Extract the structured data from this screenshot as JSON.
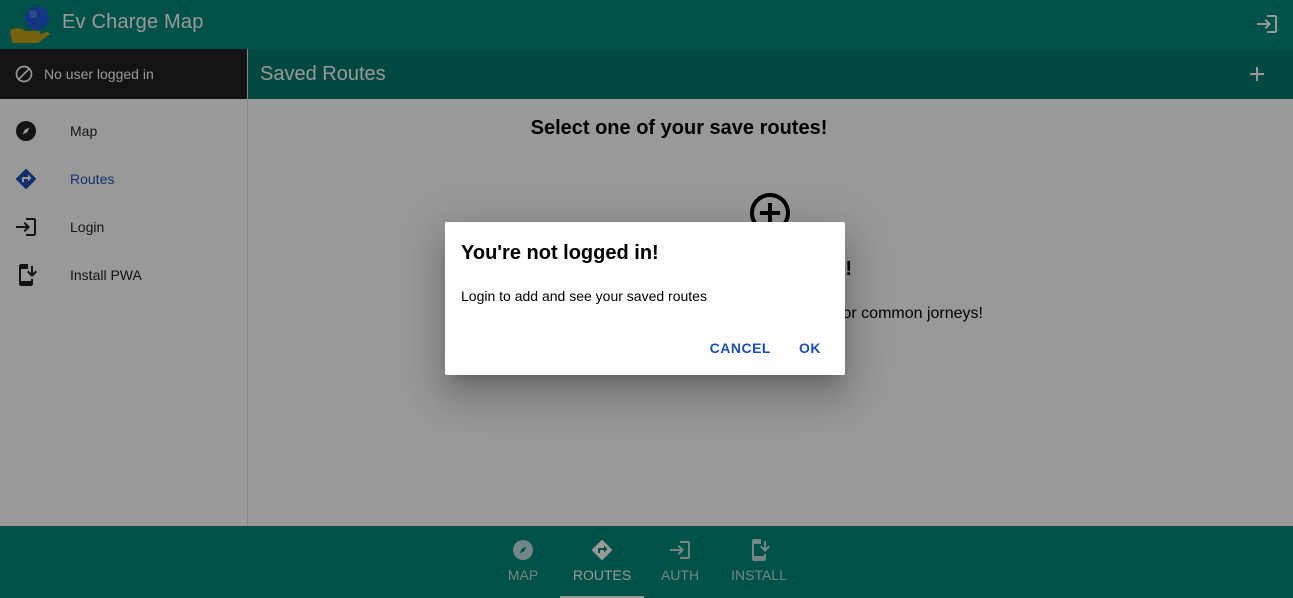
{
  "app": {
    "title": "Ev Charge Map",
    "colors": {
      "primary": "#00897b",
      "primary_dark": "#00796b",
      "accent": "#1e4fb4",
      "sidebar_header": "#212121"
    }
  },
  "sidebar": {
    "user_status": "No user logged in",
    "user_status_icon": "block-icon",
    "items": [
      {
        "label": "Map",
        "icon": "compass-icon",
        "active": false
      },
      {
        "label": "Routes",
        "icon": "directions-icon",
        "active": true
      },
      {
        "label": "Login",
        "icon": "login-icon",
        "active": false
      },
      {
        "label": "Install PWA",
        "icon": "install-mobile-icon",
        "active": false
      }
    ]
  },
  "main": {
    "toolbar_title": "Saved Routes",
    "heading": "Select one of your save routes!",
    "empty_title_visible": "!",
    "empty_text_visible": "or common jorneys!"
  },
  "bottom_nav": {
    "items": [
      {
        "label": "MAP",
        "icon": "compass-icon",
        "active": false
      },
      {
        "label": "ROUTES",
        "icon": "directions-icon",
        "active": true
      },
      {
        "label": "AUTH",
        "icon": "login-icon",
        "active": false
      },
      {
        "label": "INSTALL",
        "icon": "install-mobile-icon",
        "active": false
      }
    ]
  },
  "dialog": {
    "title": "You're not logged in!",
    "text": "Login to add and see your saved routes",
    "cancel_label": "CANCEL",
    "ok_label": "OK"
  }
}
